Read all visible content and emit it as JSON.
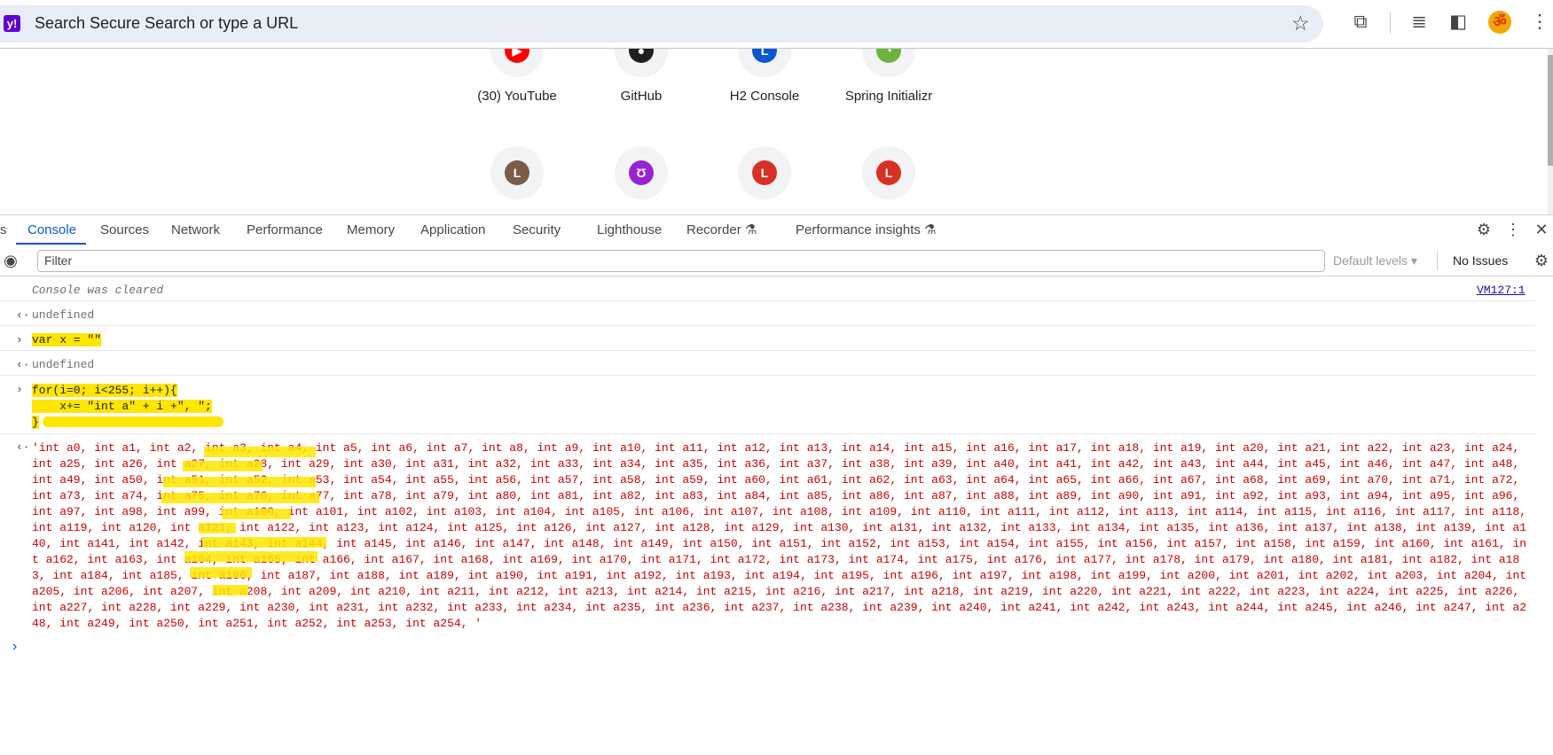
{
  "browser": {
    "omnibox_placeholder": "Search Secure Search or type a URL",
    "site_icon": "yahoo-y-icon",
    "site_icon_letter": "y!",
    "profile_glyph": "ॐ",
    "icons": [
      "star-icon",
      "extensions-icon",
      "media-controls-icon",
      "side-panel-icon",
      "profile-avatar-icon",
      "kebab-menu-icon"
    ]
  },
  "ntp": {
    "shortcuts_row1": [
      {
        "label": "(30) YouTube",
        "icon": "youtube-icon",
        "color": "#ff0000",
        "glyph": "▶"
      },
      {
        "label": "GitHub",
        "icon": "github-icon",
        "color": "#1f1f1f",
        "glyph": "●"
      },
      {
        "label": "H2 Console",
        "icon": "h2-icon",
        "color": "#0b57d0",
        "glyph": "L"
      },
      {
        "label": "Spring Initializr",
        "icon": "spring-icon",
        "color": "#6db33f",
        "glyph": "◔"
      }
    ],
    "shortcuts_row2": [
      {
        "glyph": "L",
        "color": "#7a5c48",
        "icon": "letter-l-icon"
      },
      {
        "glyph": "Ʊ",
        "color": "#9b22d1",
        "icon": "purple-u-icon"
      },
      {
        "glyph": "L",
        "color": "#d93025",
        "icon": "letter-l-icon"
      },
      {
        "glyph": "L",
        "color": "#d93025",
        "icon": "letter-l-icon"
      }
    ]
  },
  "devtools": {
    "tabs": [
      "s",
      "Console",
      "Sources",
      "Network",
      "Performance",
      "Memory",
      "Application",
      "Security",
      "Lighthouse",
      "Recorder",
      "Performance insights"
    ],
    "active_tab": "Console",
    "beaker": "⚗",
    "filter_placeholder": "Filter",
    "default_levels": "Default levels ▾",
    "no_issues": "No Issues"
  },
  "console": {
    "cleared_msg": "Console was cleared",
    "cleared_source": "VM127:1",
    "undefined1": "undefined",
    "input1": "var x = \"\"",
    "undefined2": "undefined",
    "input2_line1": "for(i=0; i<255; i++){",
    "input2_line2": "    x+= \"int a\" + i +\", \";",
    "input2_line3": "}",
    "result": "'int a0, int a1, int a2, int a3, int a4, int a5, int a6, int a7, int a8, int a9, int a10, int a11, int a12, int a13, int a14, int a15, int a16, int a17, int a18, int a19, int a20, int a21, int a22, int a23, int a24, int a25, int a26, int a27, int a28, int a29, int a30, int a31, int a32, int a33, int a34, int a35, int a36, int a37, int a38, int a39, int a40, int a41, int a42, int a43, int a44, int a45, int a46, int a47, int a48, int a49, int a50, int a51, int a52, int a53, int a54, int a55, int a56, int a57, int a58, int a59, int a60, int a61, int a62, int a63, int a64, int a65, int a66, int a67, int a68, int a69, int a70, int a71, int a72, int a73, int a74, int a75, int a76, int a77, int a78, int a79, int a80, int a81, int a82, int a83, int a84, int a85, int a86, int a87, int a88, int a89, int a90, int a91, int a92, int a93, int a94, int a95, int a96, int a97, int a98, int a99, int a100, int a101, int a102, int a103, int a104, int a105, int a106, int a107, int a108, int a109, int a110, int a111, int a112, int a113, int a114, int a115, int a116, int a117, int a118, int a119, int a120, int a121, int a122, int a123, int a124, int a125, int a126, int a127, int a128, int a129, int a130, int a131, int a132, int a133, int a134, int a135, int a136, int a137, int a138, int a139, int a140, int a141, int a142, int a143, int a144, int a145, int a146, int a147, int a148, int a149, int a150, int a151, int a152, int a153, int a154, int a155, int a156, int a157, int a158, int a159, int a160, int a161, int a162, int a163, int a164, int a165, int a166, int a167, int a168, int a169, int a170, int a171, int a172, int a173, int a174, int a175, int a176, int a177, int a178, int a179, int a180, int a181, int a182, int a183, int a184, int a185, int a186, int a187, int a188, int a189, int a190, int a191, int a192, int a193, int a194, int a195, int a196, int a197, int a198, int a199, int a200, int a201, int a202, int a203, int a204, int a205, int a206, int a207, int a208, int a209, int a210, int a211, int a212, int a213, int a214, int a215, int a216, int a217, int a218, int a219, int a220, int a221, int a222, int a223, int a224, int a225, int a226, int a227, int a228, int a229, int a230, int a231, int a232, int a233, int a234, int a235, int a236, int a237, int a238, int a239, int a240, int a241, int a242, int a243, int a244, int a245, int a246, int a247, int a248, int a249, int a250, int a251, int a252, int a253, int a254, '"
  },
  "colors": {
    "accent": "#0b57d0",
    "highlight": "#ffe600",
    "result_text": "#c80000"
  }
}
